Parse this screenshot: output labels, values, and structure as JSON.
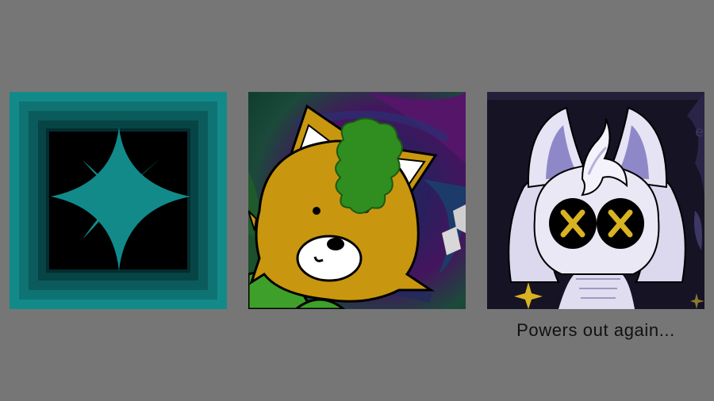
{
  "screen": {
    "background": "#767676",
    "dimmed": true
  },
  "choices": [
    {
      "icon": "teal-sparkle-icon",
      "accent": "#128a8a"
    },
    {
      "icon": "fox-character-portrait",
      "accent": "#e0a21b"
    },
    {
      "icon": "white-creature-character-portrait",
      "accent": "#d9d5ee"
    }
  ],
  "caption": {
    "text": "Powers out again..."
  }
}
